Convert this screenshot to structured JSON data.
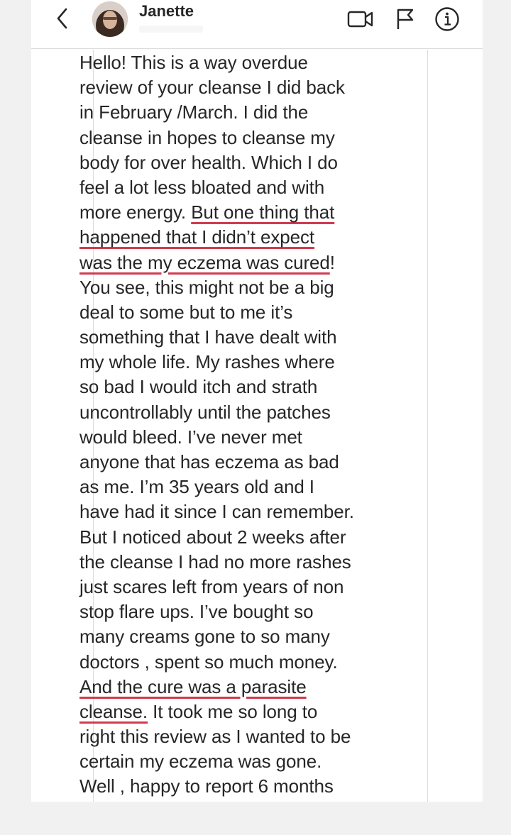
{
  "header": {
    "contact_name": "Janette",
    "back_icon": "chevron-left-icon",
    "icons": [
      "video-call-icon",
      "flag-icon",
      "info-icon"
    ]
  },
  "colors": {
    "highlight": "#d23a4e",
    "text": "#262626"
  },
  "message": {
    "lines": [
      {
        "pre": "Hello! This is a way overdue",
        "hl": "",
        "post": ""
      },
      {
        "pre": "review of your cleanse I did back",
        "hl": "",
        "post": ""
      },
      {
        "pre": "in February /March. I did the",
        "hl": "",
        "post": ""
      },
      {
        "pre": "cleanse in hopes to cleanse my",
        "hl": "",
        "post": ""
      },
      {
        "pre": "body for over health. Which I do",
        "hl": "",
        "post": ""
      },
      {
        "pre": "feel a lot less bloated and with",
        "hl": "",
        "post": ""
      },
      {
        "pre": "more energy. ",
        "hl": "But one thing that",
        "post": ""
      },
      {
        "pre": "",
        "hl": "happened that I didn’t expect",
        "post": ""
      },
      {
        "pre": "",
        "hl": "was the my eczema was cured",
        "post": "!"
      },
      {
        "pre": "You see, this might not be a big",
        "hl": "",
        "post": ""
      },
      {
        "pre": "deal to some but to me it’s",
        "hl": "",
        "post": ""
      },
      {
        "pre": "something that I have dealt with",
        "hl": "",
        "post": ""
      },
      {
        "pre": "my whole life. My rashes where",
        "hl": "",
        "post": ""
      },
      {
        "pre": "so bad I would itch and strath",
        "hl": "",
        "post": ""
      },
      {
        "pre": "uncontrollably until the patches",
        "hl": "",
        "post": ""
      },
      {
        "pre": "would bleed. I’ve never met",
        "hl": "",
        "post": ""
      },
      {
        "pre": "anyone that has eczema as bad",
        "hl": "",
        "post": ""
      },
      {
        "pre": "as me. I’m 35 years old and I",
        "hl": "",
        "post": ""
      },
      {
        "pre": "have had it since I can remember.",
        "hl": "",
        "post": ""
      },
      {
        "pre": "But I noticed about 2 weeks after",
        "hl": "",
        "post": ""
      },
      {
        "pre": "the cleanse I had no more rashes",
        "hl": "",
        "post": ""
      },
      {
        "pre": "just scares left from years of non",
        "hl": "",
        "post": ""
      },
      {
        "pre": "stop flare ups. I’ve bought so",
        "hl": "",
        "post": ""
      },
      {
        "pre": "many creams gone to so many",
        "hl": "",
        "post": ""
      },
      {
        "pre": "doctors , spent so much money.",
        "hl": "",
        "post": ""
      },
      {
        "pre": "",
        "hl": "And the cure was a parasite",
        "post": ""
      },
      {
        "pre": "",
        "hl": "cleanse.",
        "post": " It took me so long to"
      },
      {
        "pre": "right this review as I wanted to be",
        "hl": "",
        "post": ""
      },
      {
        "pre": "certain my eczema was gone.",
        "hl": "",
        "post": ""
      },
      {
        "pre": "Well , happy to report 6 months",
        "hl": "",
        "post": ""
      }
    ]
  }
}
